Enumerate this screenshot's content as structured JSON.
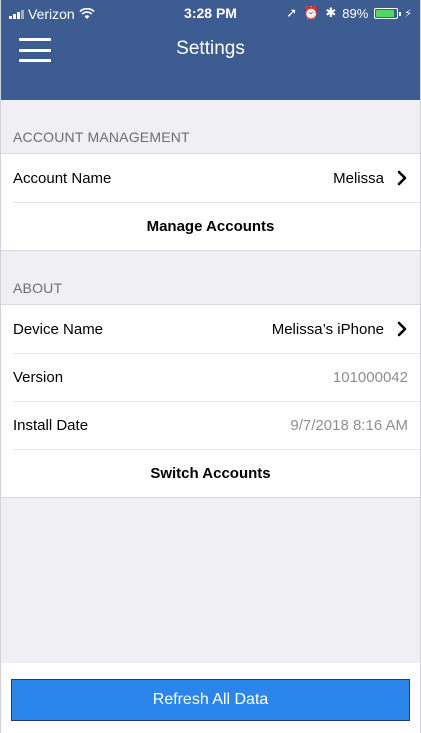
{
  "status_bar": {
    "carrier": "Verizon",
    "time": "3:28 PM",
    "battery": "89%",
    "battery_level": 0.89,
    "icons": [
      "signal-icon",
      "wifi-icon",
      "location-icon",
      "alarm-icon",
      "bluetooth-icon",
      "battery-icon",
      "charging-icon"
    ]
  },
  "nav": {
    "title": "Settings",
    "menu_icon": "hamburger-menu-icon"
  },
  "account_section": {
    "header": "ACCOUNT MANAGEMENT",
    "account_name_label": "Account Name",
    "account_name_value": "Melissa",
    "manage_accounts_label": "Manage Accounts"
  },
  "about_section": {
    "header": "ABOUT",
    "device_name_label": "Device Name",
    "device_name_value": "Melissa’s iPhone",
    "version_label": "Version",
    "version_value": "101000042",
    "install_date_label": "Install Date",
    "install_date_value": "9/7/2018 8:16 AM",
    "switch_accounts_label": "Switch Accounts"
  },
  "footer": {
    "refresh_label": "Refresh All Data"
  },
  "colors": {
    "header_bg": "#3d5d92",
    "content_bg": "#efeff4",
    "button_bg": "#2b85ea",
    "battery_green": "#4cd964"
  }
}
